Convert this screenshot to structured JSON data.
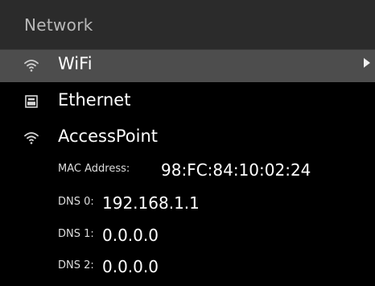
{
  "header": {
    "title": "Network"
  },
  "menu": {
    "items": [
      {
        "label": "WiFi",
        "icon": "wifi-icon",
        "selected": true,
        "has_arrow": true
      },
      {
        "label": "Ethernet",
        "icon": "ethernet-icon",
        "selected": false,
        "has_arrow": false
      },
      {
        "label": "AccessPoint",
        "icon": "access-point-icon",
        "selected": false,
        "has_arrow": false
      }
    ]
  },
  "details": {
    "mac": {
      "label": "MAC Address:",
      "value": "98:FC:84:10:02:24"
    },
    "dns0": {
      "label": "DNS 0:",
      "value": "192.168.1.1"
    },
    "dns1": {
      "label": "DNS 1:",
      "value": "0.0.0.0"
    },
    "dns2": {
      "label": "DNS 2:",
      "value": "0.0.0.0"
    }
  },
  "colors": {
    "background": "#000000",
    "header_background": "#2b2b2b",
    "selected_background": "#4d4d4d",
    "header_text": "#b8b8b8",
    "text": "#ffffff"
  }
}
